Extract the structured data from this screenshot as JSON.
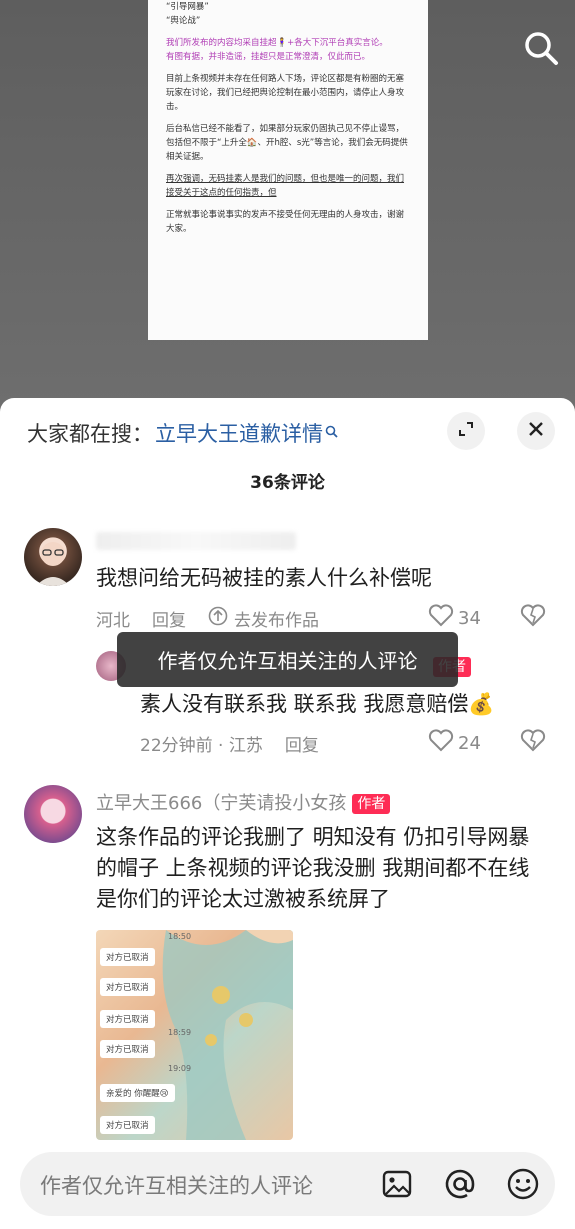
{
  "video_doc": {
    "lines": [
      "“引导网暴”",
      "“舆论战”",
      "我们所发布的内容均采自挂超🧍‍♀️+各大下沉平台真实言论。",
      "有图有据，并非造谣，挂超只是正常澄清，仅此而已。",
      "目前上条视频并未存在任何路人下场，评论区都是有粉圈的无塞玩家在讨论，我们已经把舆论控制在最小范围内，请停止人身攻击。",
      "后台私信已经不能看了，如果部分玩家仍固执己见不停止谩骂，包括但不限于“上升全🏠、开h腔、s光”等言论，我们会无码提供相关证据。",
      "再次强调，无码挂素人是我们的问题，但也是唯一的问题，我们接受关于这点的任何指责，但",
      "正常就事论事说事实的发声不接受任何无理由的人身攻击，谢谢大家。"
    ]
  },
  "search_bar": {
    "prefix": "大家都在搜：",
    "query": "立早大王道歉详情",
    "query_icon": "search-small-icon"
  },
  "comments_title": "36条评论",
  "comments": [
    {
      "text": "我想问给无码被挂的素人什么补偿呢",
      "location": "河北",
      "reply_label": "回复",
      "share_label": "去发布作品",
      "likes": "34"
    },
    {
      "is_reply": true,
      "author_tag": "作者",
      "text": "素人没有联系我 联系我 我愿意赔偿💰",
      "time_location": "22分钟前 · 江苏",
      "reply_label": "回复",
      "likes": "24"
    },
    {
      "name": "立早大王666（宁芙请投小女孩",
      "author_tag": "作者",
      "text": "这条作品的评论我删了 明知没有 仍扣引导网暴的帽子 上条视频的评论我没删 我期间都不在线 是你们的评论太过激被系统屏了"
    }
  ],
  "screenshot_chat": {
    "bubbles": [
      "对方已取消",
      "对方已取消",
      "对方已取消",
      "对方已取消",
      "亲爱的 你醒醒😢",
      "对方已取消"
    ],
    "times": [
      "18:50",
      "18:59",
      "19:09"
    ]
  },
  "toast": "作者仅允许互相关注的人评论",
  "input": {
    "placeholder": "作者仅允许互相关注的人评论"
  },
  "colors": {
    "accent_pink": "#fe2c55",
    "link_blue": "#2b5fa3"
  }
}
